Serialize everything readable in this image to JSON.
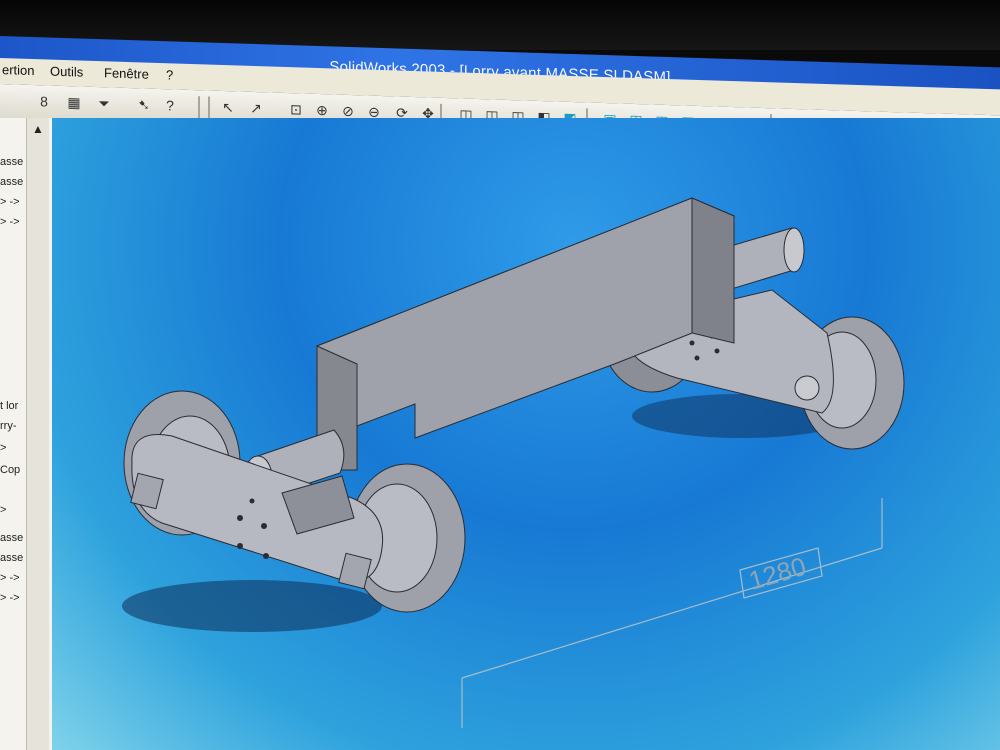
{
  "window": {
    "title": "SolidWorks 2003 - [Lorry avant MASSE.SLDASM]"
  },
  "menu": {
    "items": [
      "ertion",
      "Outils",
      "Fenêtre",
      "?"
    ]
  },
  "toolbar": {
    "buttons": [
      {
        "icon": "rebuild-icon",
        "glyph": "8"
      },
      {
        "icon": "options-icon",
        "glyph": "▦"
      },
      {
        "icon": "filter-icon",
        "glyph": "⏷"
      },
      {
        "icon": "whats-this-icon",
        "glyph": "➷"
      },
      {
        "icon": "help-icon",
        "glyph": "?"
      },
      {
        "icon": "select-icon",
        "glyph": "↖"
      },
      {
        "icon": "select-other-icon",
        "glyph": "↗"
      },
      {
        "icon": "zoom-fit-icon",
        "glyph": "⊡"
      },
      {
        "icon": "zoom-area-icon",
        "glyph": "⊕"
      },
      {
        "icon": "zoom-in-out-icon",
        "glyph": "⊘"
      },
      {
        "icon": "zoom-selection-icon",
        "glyph": "⊖"
      },
      {
        "icon": "rotate-view-icon",
        "glyph": "⟳"
      },
      {
        "icon": "pan-icon",
        "glyph": "✥"
      },
      {
        "icon": "wireframe-icon",
        "glyph": "◫"
      },
      {
        "icon": "hidden-lines-visible-icon",
        "glyph": "◫"
      },
      {
        "icon": "hidden-lines-removed-icon",
        "glyph": "◫"
      },
      {
        "icon": "shaded-with-edges-icon",
        "glyph": "◧"
      },
      {
        "icon": "shaded-icon",
        "glyph": "◩"
      },
      {
        "icon": "view-front-icon",
        "glyph": "▣"
      },
      {
        "icon": "view-back-icon",
        "glyph": "◰"
      },
      {
        "icon": "view-left-icon",
        "glyph": "◰"
      },
      {
        "icon": "view-right-icon",
        "glyph": "◰"
      },
      {
        "icon": "view-top-icon",
        "glyph": "◰"
      },
      {
        "icon": "view-bottom-icon",
        "glyph": "◰"
      },
      {
        "icon": "view-isometric-icon",
        "glyph": "⬢"
      },
      {
        "icon": "normal-to-icon",
        "glyph": "⯁"
      }
    ]
  },
  "feature_tree": {
    "items": [
      "asse",
      "asse",
      "> ->",
      "> ->",
      "t lor",
      "rry-",
      ">",
      "Cop",
      ">",
      "asse",
      "asse",
      "> ->",
      "> ->"
    ]
  },
  "viewport": {
    "dimension_value": "1280",
    "colors": {
      "part": "#b9bcc4",
      "part_dark": "#8b8e97",
      "part_light": "#d6d8de",
      "edge": "#2a2c33",
      "background_top": "#1779d4",
      "background_bottom": "#7fd3ea"
    }
  }
}
